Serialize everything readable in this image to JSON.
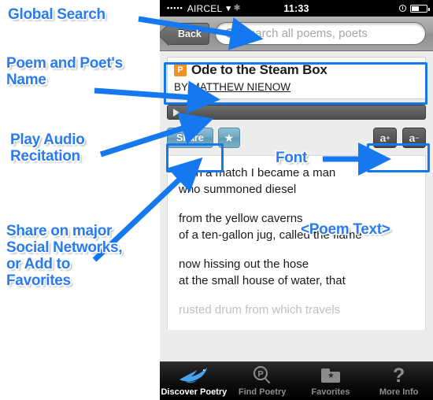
{
  "phone": {
    "status_bar": {
      "signal_dots": "•••••",
      "carrier": "AIRCEL",
      "wifi_icon": "wifi-icon",
      "activity_icon": "activity-spinner-icon",
      "time": "11:33",
      "alarm_icon": "alarm-clock-icon",
      "battery_icon": "battery-icon",
      "battery_level": "50%"
    },
    "nav_bar": {
      "back_label": "Back",
      "search_icon": "search-icon",
      "search_value": "",
      "search_placeholder": "Search all poems, poets"
    },
    "poem": {
      "badge": "P",
      "title": "Ode to the Steam Box",
      "by_prefix": "BY",
      "author": "MATTHEW NIENOW",
      "audio": {
        "play_icon": "play-icon",
        "progress": "0%"
      },
      "toolbar": {
        "share_label": "Share",
        "favorite_icon": "star-icon",
        "font_increase_label": "a",
        "font_increase_sup": "+",
        "font_decrease_label": "a",
        "font_decrease_sup": "−"
      },
      "stanzas": [
        [
          "With a match I became a man",
          "who summoned diesel"
        ],
        [
          "from the yellow caverns",
          "of a ten-gallon jug, called the flame"
        ],
        [
          "now hissing out the hose",
          "at the small house of water, that"
        ],
        [
          "rusted drum from which travels"
        ]
      ]
    },
    "tab_bar": [
      {
        "label": "Discover Poetry",
        "icon": "bird-icon",
        "active": true
      },
      {
        "label": "Find Poetry",
        "icon": "magnifier-p-icon",
        "active": false
      },
      {
        "label": "Favorites",
        "icon": "folder-star-icon",
        "active": false
      },
      {
        "label": "More Info",
        "icon": "question-mark-icon",
        "active": false
      }
    ]
  },
  "annotations": [
    {
      "id": "global_search",
      "text": "Global Search"
    },
    {
      "id": "poem_poet_name",
      "text": "Poem and Poet's\nName"
    },
    {
      "id": "play_audio",
      "text": "Play Audio\nRecitation"
    },
    {
      "id": "share_favorites",
      "text": "Share on major\nSocial Networks,\nor Add to\nFavorites"
    },
    {
      "id": "font",
      "text": "Font"
    },
    {
      "id": "poem_text",
      "text": "<Poem Text>"
    }
  ],
  "colors": {
    "annotation_blue": "#2a7bf0",
    "highlight_border": "#1578ef",
    "badge_orange": "#f29222",
    "share_button": "#6fa5bf"
  }
}
